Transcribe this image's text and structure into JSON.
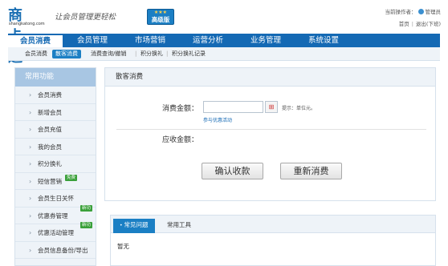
{
  "header": {
    "logo_text": "商卡通",
    "logo_url": "shangkatong.com",
    "slogan": "让会员管理更轻松",
    "edition_stars": "★★★",
    "edition_label": "高级版",
    "operator_prefix": "当前操作者：",
    "operator_name": "管理员",
    "links": {
      "home": "首页",
      "logout": "退出(下班)"
    },
    "link_separator": "|"
  },
  "nav": {
    "items": [
      {
        "label": "会员消费",
        "active": true
      },
      {
        "label": "会员管理",
        "active": false
      },
      {
        "label": "市场营销",
        "active": false
      },
      {
        "label": "运营分析",
        "active": false
      },
      {
        "label": "业务管理",
        "active": false
      },
      {
        "label": "系统设置",
        "active": false
      }
    ]
  },
  "subnav": {
    "items": [
      {
        "label": "会员消费",
        "active": false
      },
      {
        "label": "散客消费",
        "active": true
      },
      {
        "label": "消费查询/撤销",
        "active": false
      },
      {
        "label": "积分换礼",
        "active": false
      },
      {
        "label": "积分换礼记录",
        "active": false
      }
    ],
    "separator": "|"
  },
  "sidebar": {
    "title": "常用功能",
    "chevron": "›",
    "items": [
      {
        "label": "会员消费"
      },
      {
        "label": "新增会员"
      },
      {
        "label": "会员充值"
      },
      {
        "label": "我的会员"
      },
      {
        "label": "积分换礼"
      },
      {
        "label": "短信营销",
        "badge": "免费"
      },
      {
        "label": "会员生日关怀"
      },
      {
        "label": "优惠券管理",
        "badge": "新功"
      },
      {
        "label": "优惠活动管理",
        "badge": "新功"
      },
      {
        "label": "会员信息备份/导出"
      }
    ]
  },
  "panel": {
    "title": "散客消费",
    "amount_label": "消费金额：",
    "amount_value": "",
    "calc_icon": "⊞",
    "hint": "提示：单位元。",
    "promo_link": "参与优惠活动",
    "receivable_label": "应收金额：",
    "confirm_button": "确认收款",
    "reset_button": "重新消费"
  },
  "bottom_tabs": {
    "tabs": [
      {
        "label": "常见问题",
        "active": true
      },
      {
        "label": "常用工具",
        "active": false
      }
    ],
    "active_marker": "•",
    "empty_text": "暂无"
  },
  "colors": {
    "brand_blue": "#1469b4",
    "accent_blue": "#1b7fc4",
    "badge_green": "#3aa03a",
    "sidebar_header": "#a8c6e3"
  }
}
